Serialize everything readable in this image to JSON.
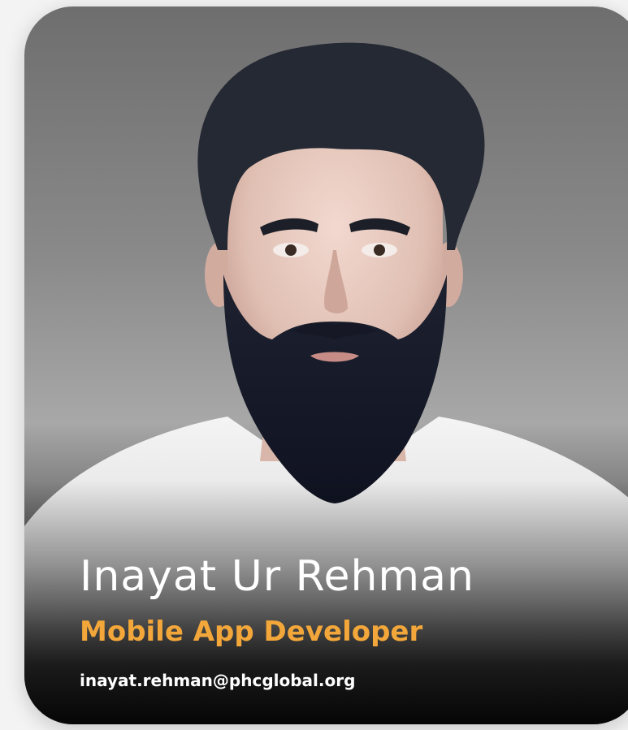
{
  "profile": {
    "name": "Inayat Ur Rehman",
    "role": "Mobile App Developer",
    "email": "inayat.rehman@phcglobal.org"
  },
  "colors": {
    "role_accent": "#f3a73a",
    "name_text": "#ffffff",
    "card_bottom": "#101010"
  }
}
